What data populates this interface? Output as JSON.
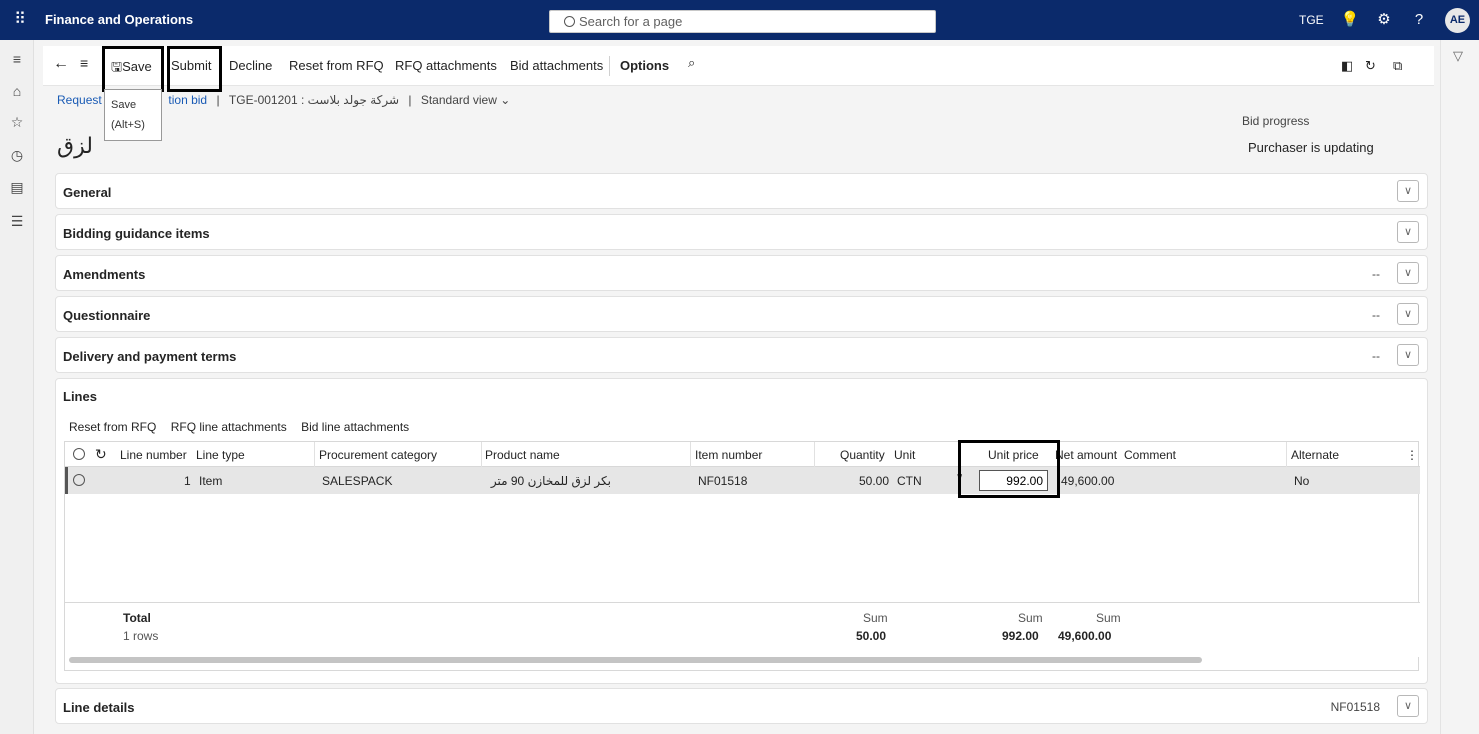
{
  "app": {
    "name": "Finance and Operations",
    "search_placeholder": "Search for a page",
    "company": "TGE",
    "avatar": "AE"
  },
  "topbar_icons": [
    "waffle-icon",
    "lightbulb-icon",
    "settings-icon",
    "help-icon"
  ],
  "leftnav_icons": [
    "hamburger-icon",
    "home-icon",
    "star-icon",
    "recent-icon",
    "workspace-icon",
    "modules-icon"
  ],
  "actionpane": {
    "save": "Save",
    "submit": "Submit",
    "decline": "Decline",
    "reset_from_rfq": "Reset from RFQ",
    "rfq_attachments": "RFQ attachments",
    "bid_attachments": "Bid attachments",
    "options": "Options"
  },
  "tooltip": {
    "title": "Save",
    "shortcut": "(Alt+S)"
  },
  "breadcrumb": {
    "link_part1": "Request",
    "link_part2": "tion bid",
    "record": "TGE-001201 : شركة جولد بلاست",
    "view": "Standard view"
  },
  "page_title": "لزق",
  "bid_progress": {
    "label": "Bid progress",
    "value": "Purchaser is updating"
  },
  "fasttabs": [
    {
      "label": "General",
      "summary": ""
    },
    {
      "label": "Bidding guidance items",
      "summary": ""
    },
    {
      "label": "Amendments",
      "summary": "--"
    },
    {
      "label": "Questionnaire",
      "summary": "--"
    },
    {
      "label": "Delivery and payment terms",
      "summary": "--"
    }
  ],
  "lines": {
    "title": "Lines",
    "toolbar": [
      "Reset from RFQ",
      "RFQ line attachments",
      "Bid line attachments"
    ],
    "columns": [
      "Line number",
      "Line type",
      "Procurement category",
      "Product name",
      "Item number",
      "Quantity",
      "Unit",
      "Unit price",
      "Net amount",
      "Comment",
      "Alternate"
    ],
    "row": {
      "line_number": "1",
      "line_type": "Item",
      "procurement_category": "SALESPACK",
      "product_name": "بكر لزق للمخازن 90 متر",
      "item_number": "NF01518",
      "quantity": "50.00",
      "unit": "CTN",
      "unit_price": "992.00",
      "net_amount": "49,600.00",
      "comment": "",
      "alternate": "No"
    },
    "totals": {
      "label": "Total",
      "rows": "1 rows",
      "sum_label": "Sum",
      "quantity_sum": "50.00",
      "unit_price_sum": "992.00",
      "net_amount_sum": "49,600.00"
    }
  },
  "line_details": {
    "label": "Line details",
    "summary": "NF01518"
  }
}
